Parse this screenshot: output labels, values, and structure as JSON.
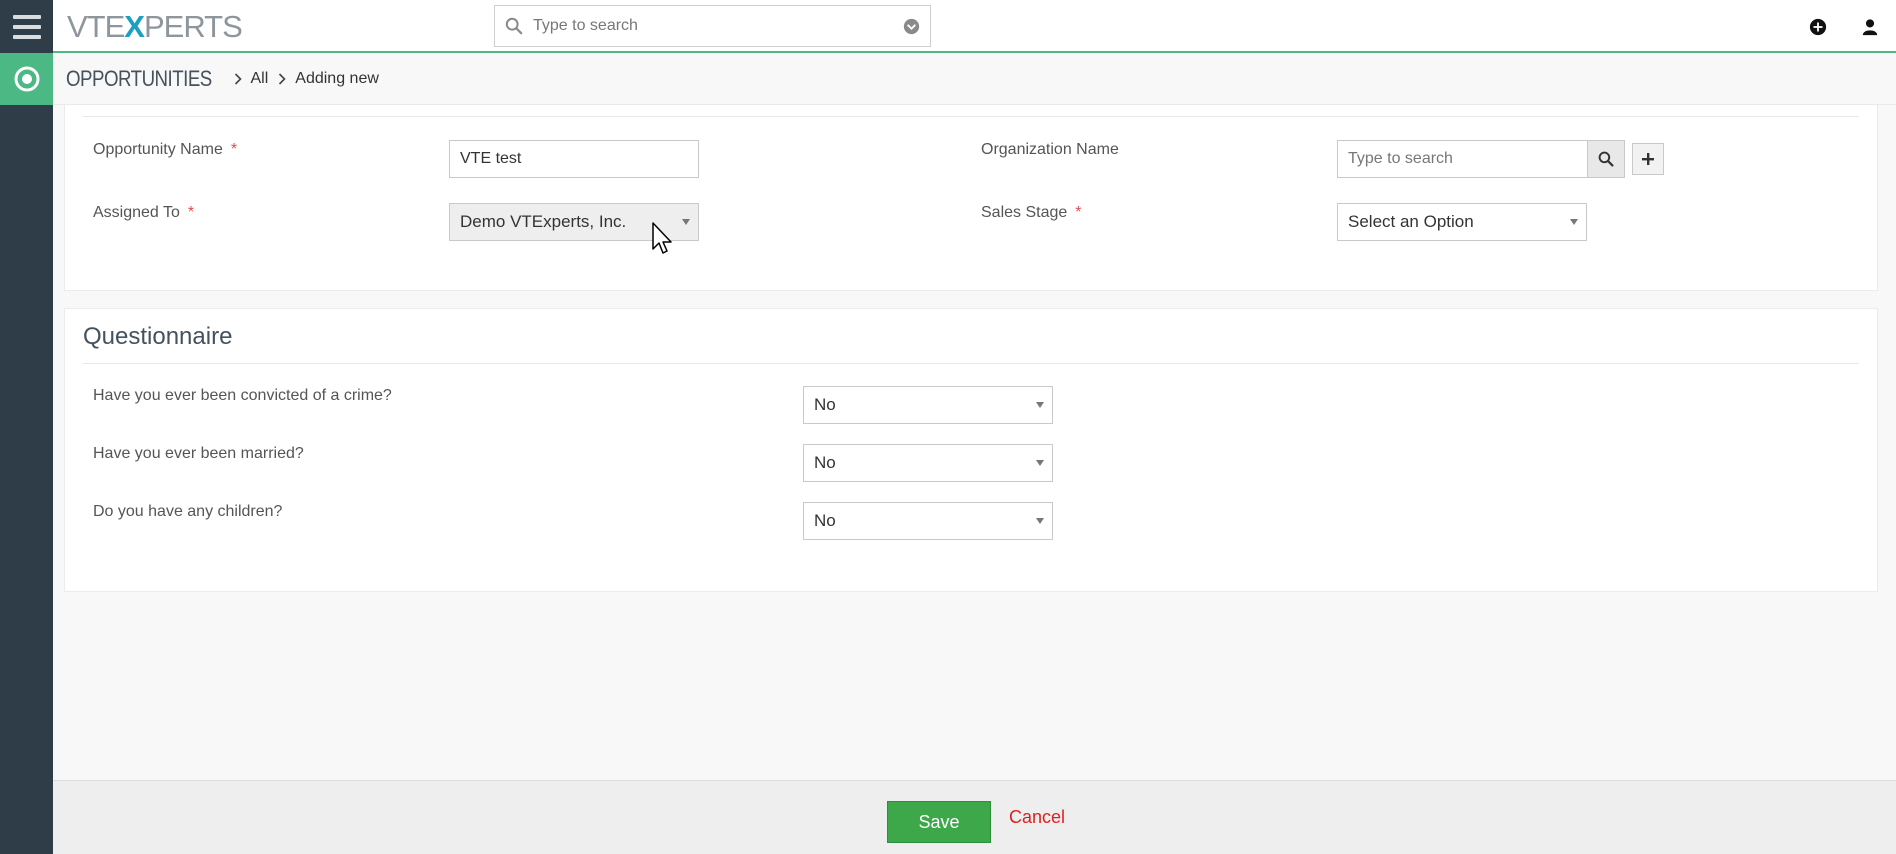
{
  "header": {
    "logo": {
      "part1": "VTE",
      "part2": "X",
      "part3": "PERTS"
    },
    "search_placeholder": "Type to search"
  },
  "breadcrumb": {
    "module": "OPPORTUNITIES",
    "items": [
      "All",
      "Adding new"
    ]
  },
  "details": {
    "opportunity_name": {
      "label": "Opportunity Name",
      "required": "*",
      "value": "VTE test"
    },
    "assigned_to": {
      "label": "Assigned To",
      "required": "*",
      "value": "Demo VTExperts, Inc."
    },
    "organization_name": {
      "label": "Organization Name",
      "placeholder": "Type to search"
    },
    "sales_stage": {
      "label": "Sales Stage",
      "required": "*",
      "value": "Select an Option"
    }
  },
  "questionnaire": {
    "title": "Questionnaire",
    "questions": [
      {
        "label": "Have you ever been convicted of a crime?",
        "value": "No"
      },
      {
        "label": "Have you ever been married?",
        "value": "No"
      },
      {
        "label": "Do you have any children?",
        "value": "No"
      }
    ]
  },
  "footer": {
    "save_label": "Save",
    "cancel_label": "Cancel"
  },
  "colors": {
    "accent_green": "#4cb884",
    "sidebar": "#2f3d48",
    "save_green": "#3ca84a",
    "cancel_red": "#e02020",
    "required_red": "#e34d4d"
  },
  "icons": [
    "menu-icon",
    "search-icon",
    "chevron-down-circle-icon",
    "plus-circle-icon",
    "user-icon",
    "module-target-icon",
    "chevron-right-icon",
    "plus-icon"
  ]
}
